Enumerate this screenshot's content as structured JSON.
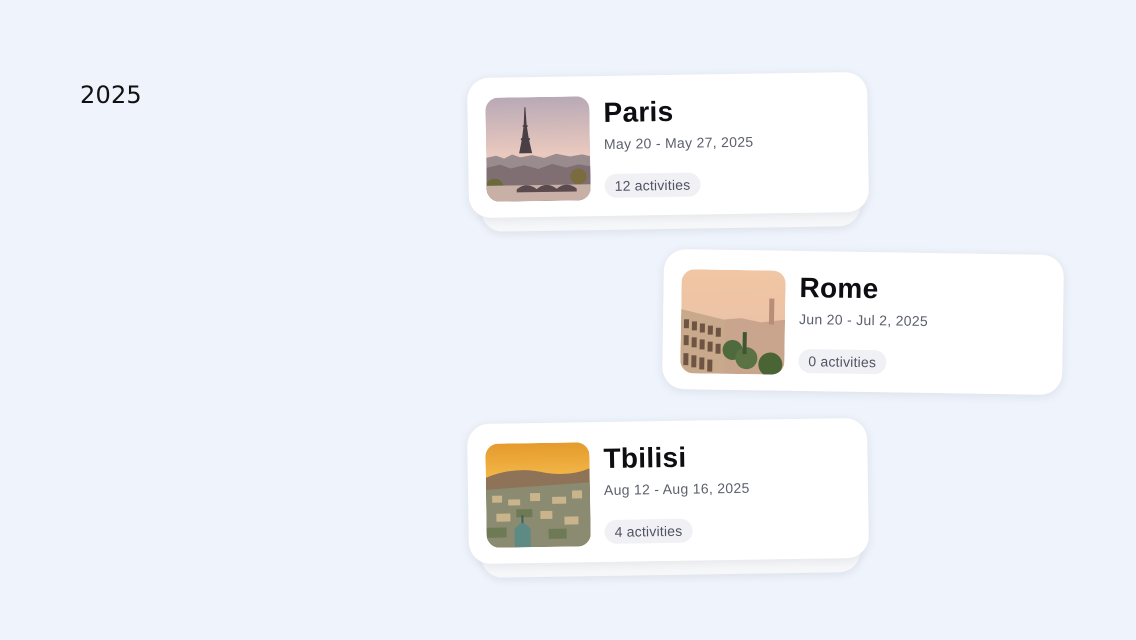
{
  "year": "2025",
  "trips": [
    {
      "city": "Paris",
      "dates": "May 20 - May 27, 2025",
      "activities": "12 activities",
      "image_icon": "eiffel-tower-photo"
    },
    {
      "city": "Rome",
      "dates": "Jun 20 - Jul 2, 2025",
      "activities": "0 activities",
      "image_icon": "colosseum-photo"
    },
    {
      "city": "Tbilisi",
      "dates": "Aug 12 - Aug 16, 2025",
      "activities": "4 activities",
      "image_icon": "tbilisi-cityscape-photo"
    }
  ]
}
